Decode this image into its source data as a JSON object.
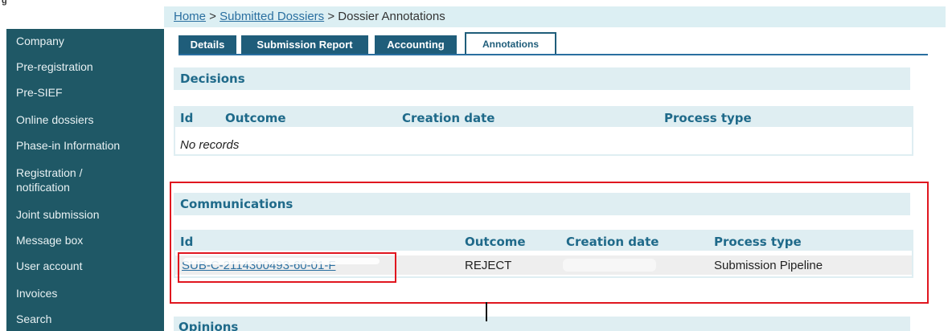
{
  "breadcrumb": {
    "home": "Home",
    "sep1": " > ",
    "submitted": "Submitted Dossiers",
    "sep2": " > ",
    "current": "Dossier Annotations"
  },
  "sidebar": {
    "items": [
      {
        "label": "Company"
      },
      {
        "label": "Pre-registration"
      },
      {
        "label": "Pre-SIEF"
      },
      {
        "label": "Online dossiers"
      },
      {
        "label": "Phase-in Information"
      },
      {
        "label": "Registration /"
      },
      {
        "label": "notification"
      },
      {
        "label": "Joint submission"
      },
      {
        "label": "Message box"
      },
      {
        "label": "User account"
      },
      {
        "label": "Invoices"
      },
      {
        "label": "Search"
      }
    ]
  },
  "tabs": [
    {
      "label": "Details"
    },
    {
      "label": "Submission Report"
    },
    {
      "label": "Accounting"
    },
    {
      "label": "Annotations",
      "active": true
    }
  ],
  "decisions": {
    "title": "Decisions",
    "columns": [
      "Id",
      "Outcome",
      "Creation date",
      "Process type"
    ],
    "empty_text": "No records"
  },
  "communications": {
    "title": "Communications",
    "columns": [
      "Id",
      "Outcome",
      "Creation date",
      "Process type"
    ],
    "rows": [
      {
        "id": "SUB-C-2114300493-60-01-F",
        "outcome": "REJECT",
        "creation_date": "",
        "process_type": "Submission Pipeline"
      }
    ]
  },
  "opinions": {
    "title": "Opinions"
  },
  "colors": {
    "sidebar_bg": "#1f5866",
    "tab_bg": "#1f5d7a",
    "header_bg": "#dfeef2",
    "header_text": "#1f6a8a",
    "highlight_red": "#e0161f"
  }
}
